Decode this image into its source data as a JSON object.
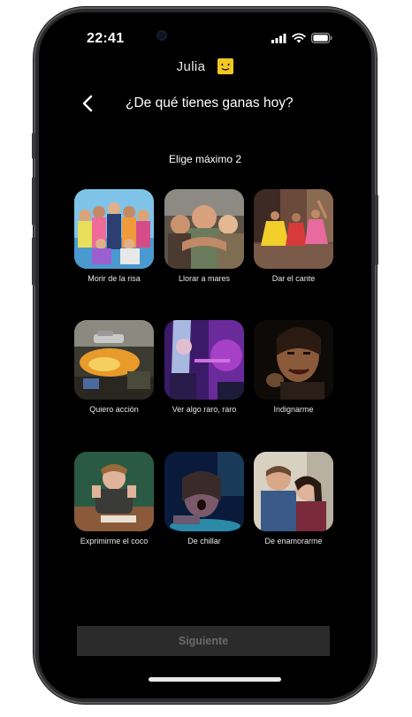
{
  "status": {
    "time": "22:41"
  },
  "profile": {
    "name": "Julia"
  },
  "header": {
    "title": "¿De qué tienes ganas hoy?"
  },
  "subtitle": "Elige máximo 2",
  "moods": [
    {
      "label": "Morir de la risa"
    },
    {
      "label": "Llorar a mares"
    },
    {
      "label": "Dar el cante"
    },
    {
      "label": "Quiero acción"
    },
    {
      "label": "Ver algo raro, raro"
    },
    {
      "label": "Indignarme"
    },
    {
      "label": "Exprimirme el coco"
    },
    {
      "label": "De chillar"
    },
    {
      "label": "De enamorarme"
    }
  ],
  "next_button": {
    "label": "Siguiente"
  },
  "colors": {
    "avatar": "#f3c623",
    "background": "#000000",
    "button_disabled": "#2b2b2b"
  }
}
